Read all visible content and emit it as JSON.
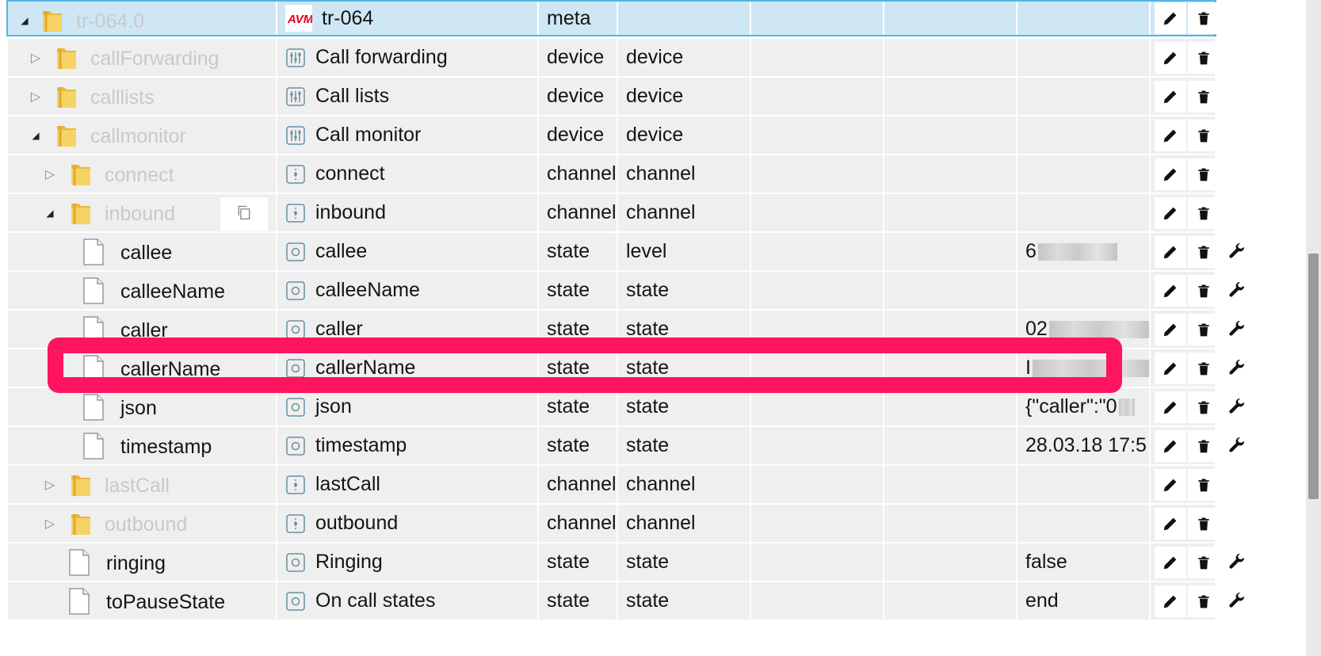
{
  "rows": [
    {
      "id": "tr-064.0",
      "kind": "folder",
      "depth": 0,
      "expanded": true,
      "selected": true,
      "name_icon": "tr064-logo-icon",
      "name": "tr-064",
      "type": "meta",
      "role": "",
      "value": "",
      "has_tool": false
    },
    {
      "id": "callForwarding",
      "kind": "folder",
      "depth": 1,
      "expanded": false,
      "name_icon": "device-icon",
      "name": "Call forwarding",
      "type": "device",
      "role": "device",
      "value": "",
      "has_tool": false
    },
    {
      "id": "calllists",
      "kind": "folder",
      "depth": 1,
      "expanded": false,
      "name_icon": "device-icon",
      "name": "Call lists",
      "type": "device",
      "role": "device",
      "value": "",
      "has_tool": false
    },
    {
      "id": "callmonitor",
      "kind": "folder",
      "depth": 1,
      "expanded": true,
      "name_icon": "device-icon",
      "name": "Call monitor",
      "type": "device",
      "role": "device",
      "value": "",
      "has_tool": false
    },
    {
      "id": "connect",
      "kind": "folder",
      "depth": 2,
      "expanded": false,
      "name_icon": "channel-icon",
      "name": "connect",
      "type": "channel",
      "role": "channel",
      "value": "",
      "has_tool": false
    },
    {
      "id": "inbound",
      "kind": "folder",
      "depth": 2,
      "expanded": true,
      "name_icon": "channel-icon",
      "name": "inbound",
      "type": "channel",
      "role": "channel",
      "value": "",
      "has_tool": false,
      "copy": true
    },
    {
      "id": "callee",
      "kind": "state",
      "depth": 3,
      "name_icon": "state-icon",
      "name": "callee",
      "type": "state",
      "role": "level",
      "value": "6",
      "blur": 100,
      "has_tool": true
    },
    {
      "id": "calleeName",
      "kind": "state",
      "depth": 3,
      "name_icon": "state-icon",
      "name": "calleeName",
      "type": "state",
      "role": "state",
      "value": "",
      "has_tool": true
    },
    {
      "id": "caller",
      "kind": "state",
      "depth": 3,
      "name_icon": "state-icon",
      "name": "caller",
      "type": "state",
      "role": "state",
      "value": "02",
      "blur": 130,
      "has_tool": true
    },
    {
      "id": "callerName",
      "kind": "state",
      "depth": 3,
      "name_icon": "state-icon",
      "name": "callerName",
      "type": "state",
      "role": "state",
      "value": "I",
      "blur": 150,
      "has_tool": true
    },
    {
      "id": "json",
      "kind": "state",
      "depth": 3,
      "name_icon": "state-icon",
      "name": "json",
      "type": "state",
      "role": "state",
      "value": "{\"caller\":\"0",
      "blur": 20,
      "has_tool": true
    },
    {
      "id": "timestamp",
      "kind": "state",
      "depth": 3,
      "name_icon": "state-icon",
      "name": "timestamp",
      "type": "state",
      "role": "state",
      "value": "28.03.18 17:5",
      "has_tool": true
    },
    {
      "id": "lastCall",
      "kind": "folder",
      "depth": 2,
      "expanded": false,
      "name_icon": "channel-icon",
      "name": "lastCall",
      "type": "channel",
      "role": "channel",
      "value": "",
      "has_tool": false
    },
    {
      "id": "outbound",
      "kind": "folder",
      "depth": 2,
      "expanded": false,
      "name_icon": "channel-icon",
      "name": "outbound",
      "type": "channel",
      "role": "channel",
      "value": "",
      "has_tool": false
    },
    {
      "id": "ringing",
      "kind": "state",
      "depth": 2,
      "name_icon": "state-icon",
      "name": "Ringing",
      "type": "state",
      "role": "state",
      "value": "false",
      "has_tool": true
    },
    {
      "id": "toPauseState",
      "kind": "state",
      "depth": 2,
      "name_icon": "state-icon",
      "name": "On call states",
      "type": "state",
      "role": "state",
      "value": "end",
      "has_tool": true
    }
  ]
}
